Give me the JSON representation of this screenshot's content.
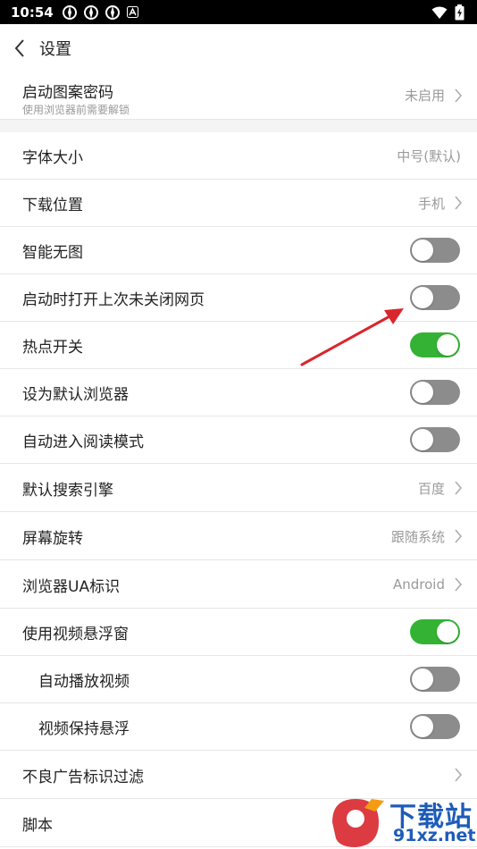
{
  "status": {
    "time": "10:54"
  },
  "header": {
    "title": "设置"
  },
  "rows": [
    {
      "label": "启动图案密码",
      "sub": "使用浏览器前需要解锁",
      "value": "未启用"
    },
    {
      "label": "字体大小",
      "value": "中号(默认)"
    },
    {
      "label": "下载位置",
      "value": "手机"
    },
    {
      "label": "智能无图",
      "toggle": "off"
    },
    {
      "label": "启动时打开上次未关闭网页",
      "toggle": "off"
    },
    {
      "label": "热点开关",
      "toggle": "on"
    },
    {
      "label": "设为默认浏览器",
      "toggle": "off"
    },
    {
      "label": "自动进入阅读模式",
      "toggle": "off"
    },
    {
      "label": "默认搜索引擎",
      "value": "百度"
    },
    {
      "label": "屏幕旋转",
      "value": "跟随系统"
    },
    {
      "label": "浏览器UA标识",
      "value": "Android"
    },
    {
      "label": "使用视频悬浮窗",
      "toggle": "on"
    },
    {
      "label": "自动播放视频",
      "toggle": "off"
    },
    {
      "label": "视频保持悬浮",
      "toggle": "off"
    },
    {
      "label": "不良广告标识过滤"
    },
    {
      "label": "脚本"
    }
  ],
  "watermark": {
    "line1": "下载站",
    "line2": "91xz.net"
  },
  "colors": {
    "toggle_on": "#34b233",
    "toggle_off": "#8c8c8c",
    "arrow": "#d9262c"
  }
}
